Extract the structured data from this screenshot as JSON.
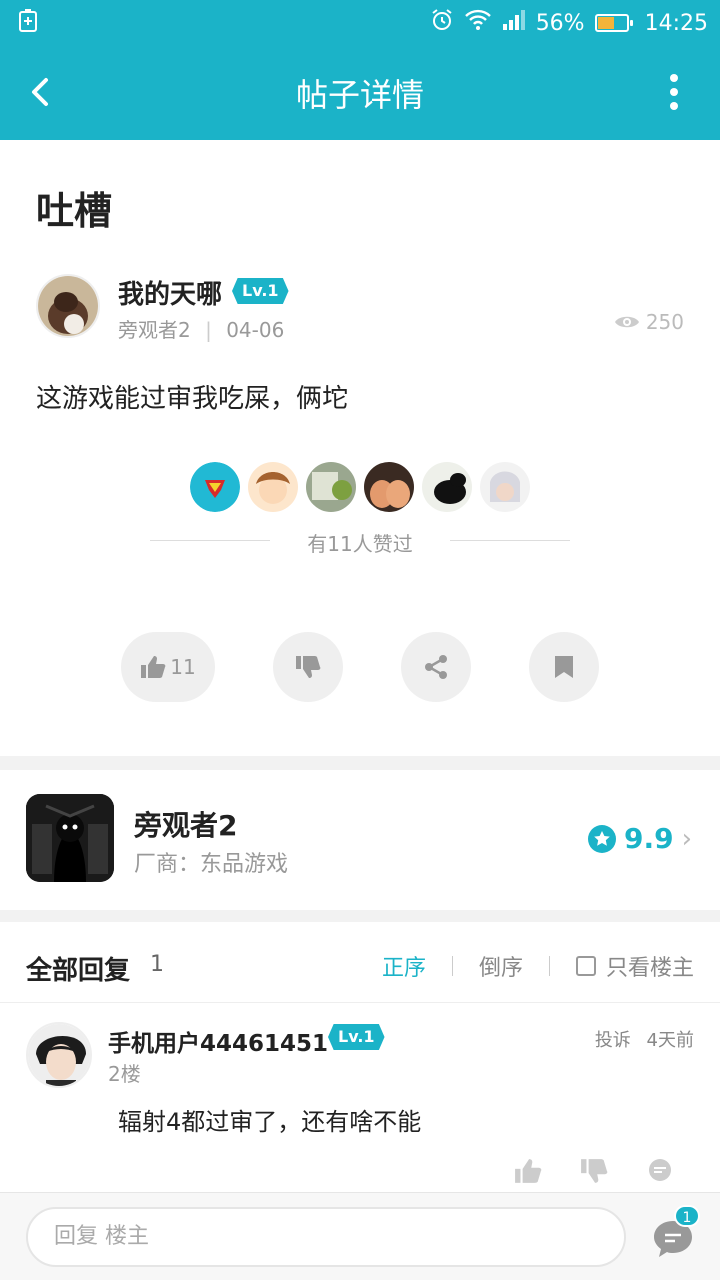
{
  "status_bar": {
    "battery_pct": "56%",
    "time": "14:25"
  },
  "app_bar": {
    "title": "帖子详情"
  },
  "post": {
    "title": "吐槽",
    "author": {
      "name": "我的天哪",
      "level": "Lv.1",
      "source": "旁观者2",
      "date": "04-06"
    },
    "views": "250",
    "content": "这游戏能过审我吃屎，俩坨",
    "likes_text": "有11人赞过",
    "like_count": "11"
  },
  "game": {
    "name": "旁观者2",
    "developer": "厂商：东品游戏",
    "score": "9.9"
  },
  "replies": {
    "header": "全部回复",
    "count": "1",
    "sort_asc": "正序",
    "sort_desc": "倒序",
    "only_op": "只看楼主",
    "items": [
      {
        "user": "手机用户44461451",
        "level": "Lv.1",
        "floor": "2楼",
        "report": "投诉",
        "time": "4天前",
        "text": "辐射4都过审了，还有啥不能"
      }
    ]
  },
  "bottom": {
    "placeholder": "回复 楼主",
    "comment_badge": "1"
  },
  "colors": {
    "accent": "#1bb3c8"
  }
}
